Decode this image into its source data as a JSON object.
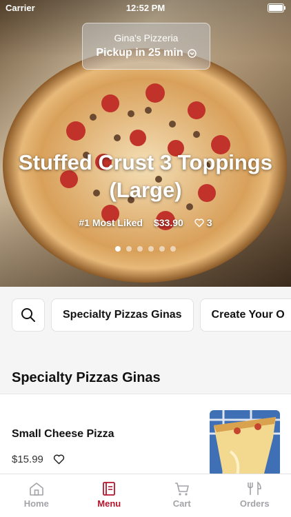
{
  "status_bar": {
    "carrier": "Carrier",
    "time": "12:52 PM"
  },
  "store": {
    "name": "Gina's Pizzeria",
    "pickup": "Pickup in 25 min"
  },
  "hero": {
    "title": "Stuffed Crust 3 Toppings (Large)",
    "badge": "#1 Most Liked",
    "price": "$33.90",
    "likes": "3",
    "carousel": {
      "count": 6,
      "active_index": 0
    }
  },
  "categories": {
    "search_icon": "search-icon",
    "items": [
      "Specialty Pizzas Ginas",
      "Create Your O"
    ]
  },
  "section": {
    "title": "Specialty Pizzas Ginas"
  },
  "menu_items": [
    {
      "name": "Small Cheese Pizza",
      "price": "$15.99"
    }
  ],
  "tabs": [
    {
      "label": "Home",
      "icon": "home-icon"
    },
    {
      "label": "Menu",
      "icon": "menu-icon",
      "active": true
    },
    {
      "label": "Cart",
      "icon": "cart-icon"
    },
    {
      "label": "Orders",
      "icon": "orders-icon"
    }
  ],
  "colors": {
    "accent": "#b5142c",
    "inactive_tab": "#a3a3a8"
  }
}
